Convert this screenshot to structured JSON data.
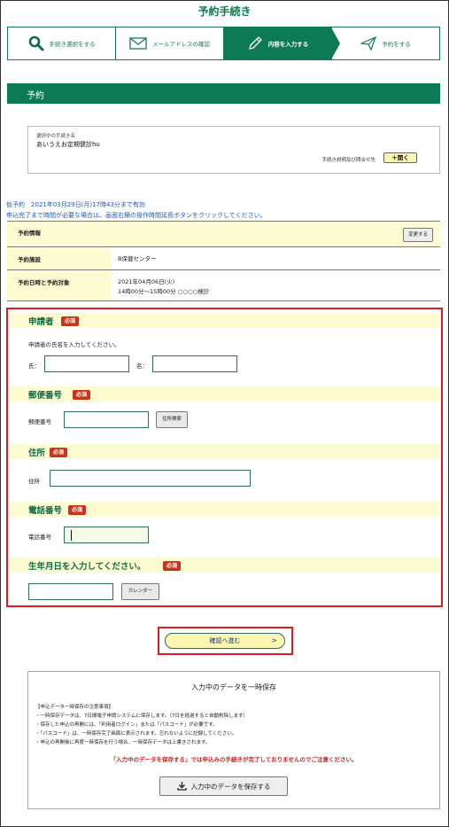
{
  "page": {
    "title": "予約手続き"
  },
  "steps": [
    {
      "label": "手続き選択をする",
      "icon": "search-icon",
      "active": false
    },
    {
      "label": "メールアドレスの確認",
      "icon": "mail-icon",
      "active": false
    },
    {
      "label": "内容を入力する",
      "icon": "pencil-icon",
      "active": true
    },
    {
      "label": "予約をする",
      "icon": "send-icon",
      "active": false
    }
  ],
  "section": {
    "title": "予約"
  },
  "procedure": {
    "label": "選択中の手続き名",
    "name": "あいうえお定期健診hu",
    "help_label": "手続き説明及び問合せ先",
    "open_button": "＋開く"
  },
  "notice": {
    "line1": "仮予約　2021年03月29日(月)17時43分まで有効",
    "line2": "申込完了まで時間が必要な場合は、画面右横の操作時間延長ボタンをクリックしてください。"
  },
  "reservation": {
    "header": "予約情報",
    "change_button": "変更する",
    "facility_label": "予約施設",
    "facility_value": "B保健センター",
    "datetime_label": "予約日時と予約対象",
    "date_value": "2021年04月06日(火)",
    "time_value": "14時00分～15時00分 ○○○○検診"
  },
  "form": {
    "required_badge": "必須",
    "applicant": {
      "title": "申請者",
      "instruction": "申請者の氏名を入力してください。",
      "last_name_label": "氏：",
      "first_name_label": "名：",
      "last_name_value": "",
      "first_name_value": ""
    },
    "postal": {
      "title": "郵便番号",
      "field_label": "郵便番号",
      "value": "",
      "search_button": "住所検索"
    },
    "address": {
      "title": "住所",
      "field_label": "住所",
      "value": ""
    },
    "phone": {
      "title": "電話番号",
      "field_label": "電話番号",
      "value": ""
    },
    "birthdate": {
      "title": "生年月日を入力してください。",
      "value": "",
      "calendar_button": "カレンダー"
    }
  },
  "confirm": {
    "label": "確認へ進む",
    "arrow": ">"
  },
  "save": {
    "title": "入力中のデータを一時保存",
    "notes": [
      "【申込データ一時保存の注意事項】",
      "・一時保存データは、7日間電子申請システムに保存します。（7日を経過すると自動削除します）",
      "・保存した申込の再開には、「利用者ログイン」または「パスコード」が必要です。",
      "・「パスコード」は、一時保存完了画面に表示されます。忘れないように記録してください。",
      "・申込の再開後に再度一時保存を行う場合、一時保存データは上書きされます。"
    ],
    "warning": "「入力中のデータを保存する」では申込みの手続きが完了しておりませんのでご注意ください。",
    "button": "入力中のデータを保存する"
  },
  "colors": {
    "brand_green": "#0d7a56",
    "required_red": "#c7351c",
    "highlight_red": "#d81e1e",
    "band_yellow": "#fdfbd1"
  }
}
